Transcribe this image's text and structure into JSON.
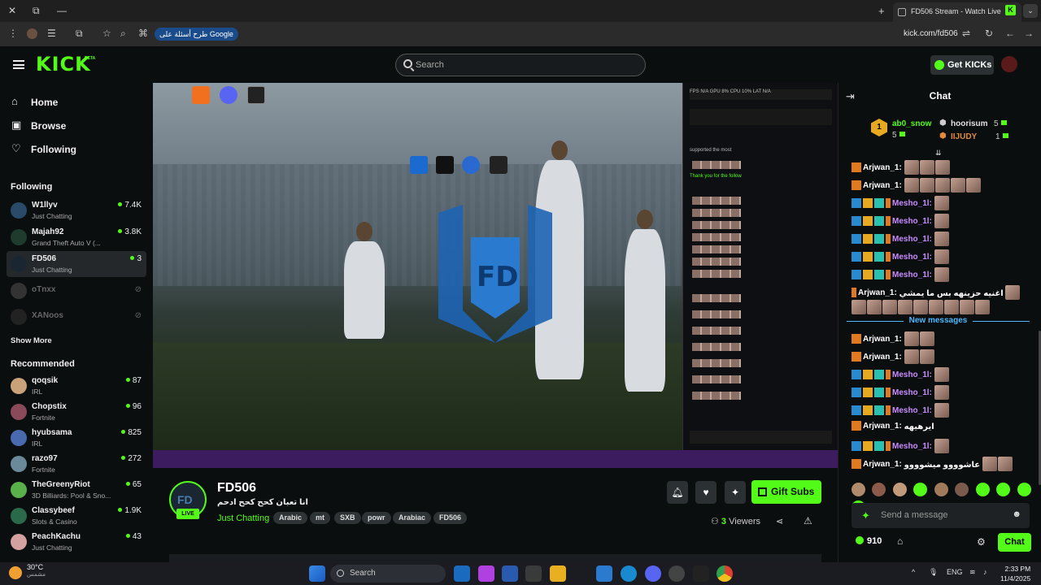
{
  "browser": {
    "tab_title": "FD506 Stream - Watch Live",
    "google_chip": "طرح أسئلة على Google",
    "url": "kick.com/fd506"
  },
  "header": {
    "logo": "KICK",
    "beta": "BETA",
    "search_placeholder": "Search",
    "get_kicks": "Get KICKs"
  },
  "nav": {
    "home": "Home",
    "browse": "Browse",
    "following": "Following"
  },
  "following_section": {
    "title": "Following",
    "channels": [
      {
        "name": "W1llyv",
        "category": "Just Chatting",
        "viewers": "7.4K",
        "avatar_color": "#2a4a6a"
      },
      {
        "name": "Majah92",
        "category": "Grand Theft Auto V (...",
        "viewers": "3.8K",
        "avatar_color": "#1e3b2e"
      },
      {
        "name": "FD506",
        "category": "Just Chatting",
        "viewers": "3",
        "avatar_color": "#1a2733"
      },
      {
        "name": "oTnxx",
        "category": "",
        "viewers": "",
        "avatar_color": "#333"
      },
      {
        "name": "XANoos",
        "category": "",
        "viewers": "",
        "avatar_color": "#222"
      }
    ],
    "show_more": "Show More"
  },
  "recommended_section": {
    "title": "Recommended",
    "channels": [
      {
        "name": "qoqsik",
        "category": "IRL",
        "viewers": "87",
        "avatar_color": "#c9a27a"
      },
      {
        "name": "Chopstix",
        "category": "Fortnite",
        "viewers": "96",
        "avatar_color": "#8a4a5a"
      },
      {
        "name": "hyubsama",
        "category": "IRL",
        "viewers": "825",
        "avatar_color": "#4a6ab0"
      },
      {
        "name": "razo97",
        "category": "Fortnite",
        "viewers": "272",
        "avatar_color": "#6a8a9a"
      },
      {
        "name": "TheGreenyRiot",
        "category": "3D Billiards: Pool & Sno...",
        "viewers": "65",
        "avatar_color": "#5ab04a"
      },
      {
        "name": "Classybeef",
        "category": "Slots & Casino",
        "viewers": "1.9K",
        "avatar_color": "#2a6a4a"
      },
      {
        "name": "PeachKachu",
        "category": "Just Chatting",
        "viewers": "43",
        "avatar_color": "#d4a0a0"
      }
    ]
  },
  "stream": {
    "streamer": "FD506",
    "live": "LIVE",
    "title": "انا تعبان كحح كحح ادحم",
    "category": "Just Chatting",
    "tags": [
      "Arabic",
      "mt",
      "SXB",
      "powr",
      "Arabiac",
      "FD506"
    ],
    "gift_subs": "Gift Subs",
    "viewers_count": "3",
    "viewers_label": "Viewers"
  },
  "chat": {
    "title": "Chat",
    "leaderboard": [
      {
        "rank": "1",
        "name": "ab0_snow",
        "count": "5",
        "color": "#53fc18"
      },
      {
        "rank": "2",
        "name": "hoorisum",
        "count": "5",
        "color": "#e0e0e0"
      },
      {
        "rank": "3",
        "name": "IIJUDY",
        "count": "1",
        "color": "#e08a3a"
      }
    ],
    "messages": [
      {
        "user": "Arjwan_1:",
        "color": "#ffffff",
        "text": "",
        "emotes": 3,
        "badges": 1
      },
      {
        "user": "Arjwan_1:",
        "color": "#ffffff",
        "text": "",
        "emotes": 5,
        "badges": 1
      },
      {
        "user": "Mesho_1l:",
        "color": "#c98bff",
        "text": "",
        "emotes": 1,
        "badges": 3
      },
      {
        "user": "Mesho_1l:",
        "color": "#c98bff",
        "text": "",
        "emotes": 1,
        "badges": 3
      },
      {
        "user": "Mesho_1l:",
        "color": "#c98bff",
        "text": "",
        "emotes": 1,
        "badges": 3
      },
      {
        "user": "Mesho_1l:",
        "color": "#c98bff",
        "text": "",
        "emotes": 1,
        "badges": 3
      },
      {
        "user": "Mesho_1l:",
        "color": "#c98bff",
        "text": "",
        "emotes": 1,
        "badges": 3
      }
    ],
    "long_message": {
      "user": "Arjwan_1:",
      "text": "اغنيه حزينهه بس ما يمشي"
    },
    "new_messages_label": "New messages",
    "new_messages": [
      {
        "user": "Arjwan_1:",
        "color": "#ffffff",
        "text": "",
        "emotes": 2,
        "badges": 1
      },
      {
        "user": "Arjwan_1:",
        "color": "#ffffff",
        "text": "",
        "emotes": 2,
        "badges": 1
      },
      {
        "user": "Mesho_1l:",
        "color": "#c98bff",
        "text": "",
        "emotes": 1,
        "badges": 3
      },
      {
        "user": "Mesho_1l:",
        "color": "#c98bff",
        "text": "",
        "emotes": 1,
        "badges": 3
      },
      {
        "user": "Mesho_1l:",
        "color": "#c98bff",
        "text": "",
        "emotes": 1,
        "badges": 3
      },
      {
        "user": "Arjwan_1:",
        "color": "#ffffff",
        "text": "ايرهيهه",
        "emotes": 0,
        "badges": 1
      },
      {
        "user": "Mesho_1l:",
        "color": "#c98bff",
        "text": "",
        "emotes": 1,
        "badges": 3
      },
      {
        "user": "Arjwan_1:",
        "color": "#ffffff",
        "text": "عاشوووو ميشوووو",
        "emotes": 2,
        "badges": 1
      }
    ],
    "input_placeholder": "Send a message",
    "kicks_balance": "910",
    "chat_button": "Chat"
  },
  "taskbar": {
    "temperature": "30°C",
    "weather_text": "مشمس",
    "search": "Search",
    "lang": "ENG",
    "time": "2:33 PM",
    "date": "11/4/2025"
  },
  "colors": {
    "accent": "#53fc18",
    "bg": "#0b0e0f"
  }
}
